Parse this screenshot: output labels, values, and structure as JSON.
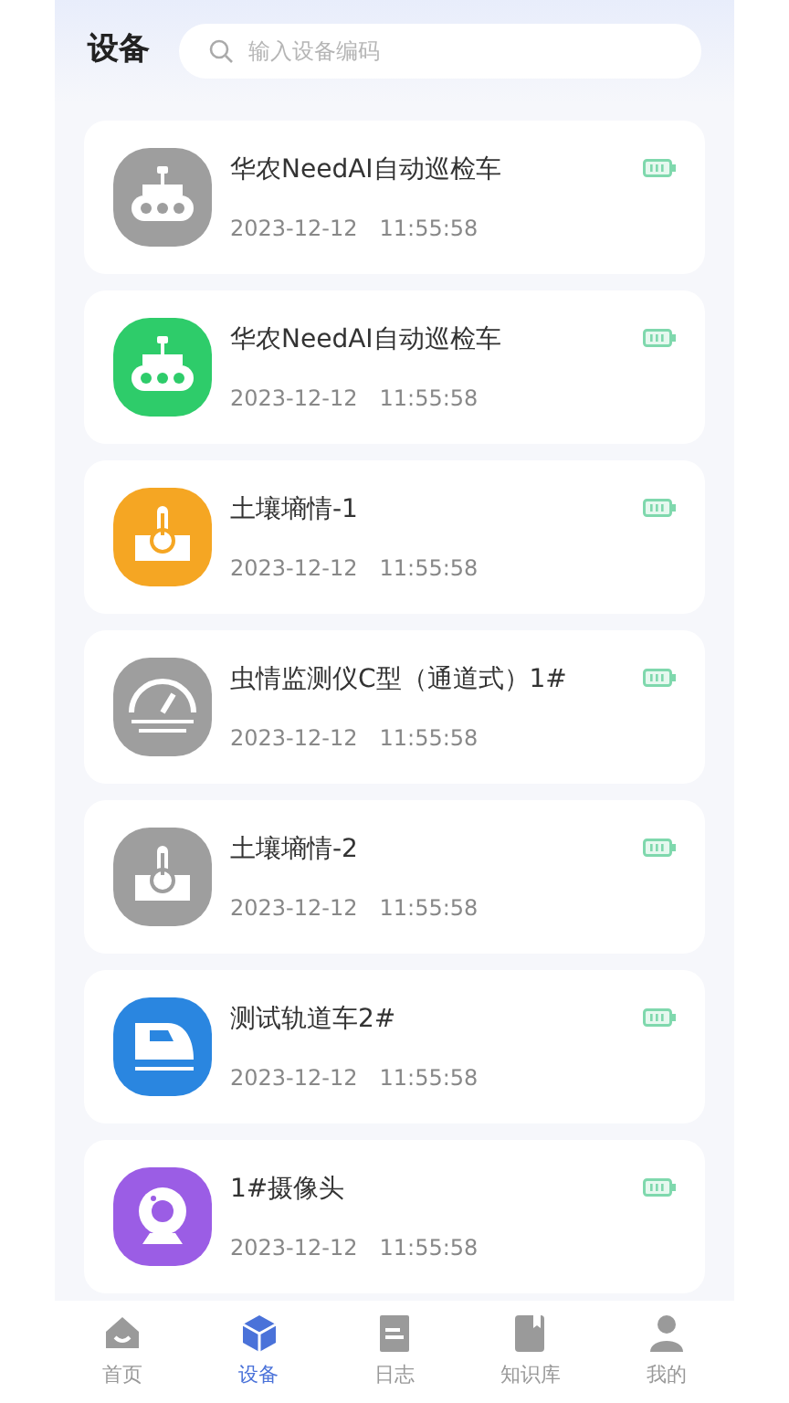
{
  "header": {
    "title": "设备",
    "search": {
      "placeholder": "输入设备编码"
    }
  },
  "devices": [
    {
      "name": "华农NeedAI自动巡检车",
      "date": "2023-12-12",
      "time": "11:55:58",
      "kind": "rover",
      "color": "#9e9e9e"
    },
    {
      "name": "华农NeedAI自动巡检车",
      "date": "2023-12-12",
      "time": "11:55:58",
      "kind": "rover",
      "color": "#2ecc6a"
    },
    {
      "name": "土壤墒情-1",
      "date": "2023-12-12",
      "time": "11:55:58",
      "kind": "soil",
      "color": "#f5a623"
    },
    {
      "name": "虫情监测仪C型（通道式）1#",
      "date": "2023-12-12",
      "time": "11:55:58",
      "kind": "gauge",
      "color": "#9e9e9e"
    },
    {
      "name": "土壤墒情-2",
      "date": "2023-12-12",
      "time": "11:55:58",
      "kind": "soil",
      "color": "#9e9e9e"
    },
    {
      "name": "测试轨道车2#",
      "date": "2023-12-12",
      "time": "11:55:58",
      "kind": "train",
      "color": "#2a86e0"
    },
    {
      "name": "1#摄像头",
      "date": "2023-12-12",
      "time": "11:55:58",
      "kind": "camera",
      "color": "#9b5de5"
    }
  ],
  "nav": [
    {
      "label": "首页",
      "kind": "home",
      "selected": false
    },
    {
      "label": "设备",
      "kind": "device",
      "selected": true
    },
    {
      "label": "日志",
      "kind": "log",
      "selected": false
    },
    {
      "label": "知识库",
      "kind": "book",
      "selected": false
    },
    {
      "label": "我的",
      "kind": "user",
      "selected": false
    }
  ]
}
